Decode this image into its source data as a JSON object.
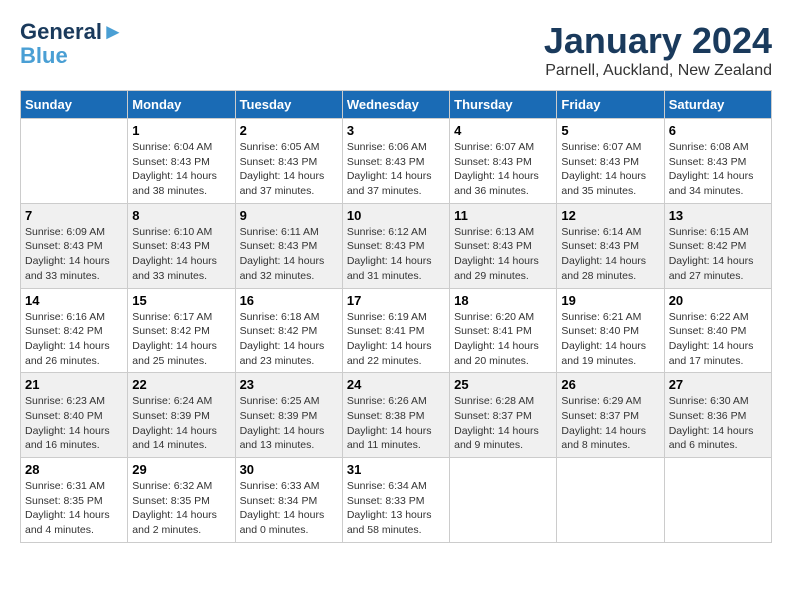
{
  "header": {
    "logo_line1": "General",
    "logo_line2": "Blue",
    "main_title": "January 2024",
    "subtitle": "Parnell, Auckland, New Zealand"
  },
  "calendar": {
    "headers": [
      "Sunday",
      "Monday",
      "Tuesday",
      "Wednesday",
      "Thursday",
      "Friday",
      "Saturday"
    ],
    "rows": [
      [
        {
          "day": "",
          "sunrise": "",
          "sunset": "",
          "daylight": ""
        },
        {
          "day": "1",
          "sunrise": "6:04 AM",
          "sunset": "8:43 PM",
          "daylight": "14 hours and 38 minutes."
        },
        {
          "day": "2",
          "sunrise": "6:05 AM",
          "sunset": "8:43 PM",
          "daylight": "14 hours and 37 minutes."
        },
        {
          "day": "3",
          "sunrise": "6:06 AM",
          "sunset": "8:43 PM",
          "daylight": "14 hours and 37 minutes."
        },
        {
          "day": "4",
          "sunrise": "6:07 AM",
          "sunset": "8:43 PM",
          "daylight": "14 hours and 36 minutes."
        },
        {
          "day": "5",
          "sunrise": "6:07 AM",
          "sunset": "8:43 PM",
          "daylight": "14 hours and 35 minutes."
        },
        {
          "day": "6",
          "sunrise": "6:08 AM",
          "sunset": "8:43 PM",
          "daylight": "14 hours and 34 minutes."
        }
      ],
      [
        {
          "day": "7",
          "sunrise": "6:09 AM",
          "sunset": "8:43 PM",
          "daylight": "14 hours and 33 minutes."
        },
        {
          "day": "8",
          "sunrise": "6:10 AM",
          "sunset": "8:43 PM",
          "daylight": "14 hours and 33 minutes."
        },
        {
          "day": "9",
          "sunrise": "6:11 AM",
          "sunset": "8:43 PM",
          "daylight": "14 hours and 32 minutes."
        },
        {
          "day": "10",
          "sunrise": "6:12 AM",
          "sunset": "8:43 PM",
          "daylight": "14 hours and 31 minutes."
        },
        {
          "day": "11",
          "sunrise": "6:13 AM",
          "sunset": "8:43 PM",
          "daylight": "14 hours and 29 minutes."
        },
        {
          "day": "12",
          "sunrise": "6:14 AM",
          "sunset": "8:43 PM",
          "daylight": "14 hours and 28 minutes."
        },
        {
          "day": "13",
          "sunrise": "6:15 AM",
          "sunset": "8:42 PM",
          "daylight": "14 hours and 27 minutes."
        }
      ],
      [
        {
          "day": "14",
          "sunrise": "6:16 AM",
          "sunset": "8:42 PM",
          "daylight": "14 hours and 26 minutes."
        },
        {
          "day": "15",
          "sunrise": "6:17 AM",
          "sunset": "8:42 PM",
          "daylight": "14 hours and 25 minutes."
        },
        {
          "day": "16",
          "sunrise": "6:18 AM",
          "sunset": "8:42 PM",
          "daylight": "14 hours and 23 minutes."
        },
        {
          "day": "17",
          "sunrise": "6:19 AM",
          "sunset": "8:41 PM",
          "daylight": "14 hours and 22 minutes."
        },
        {
          "day": "18",
          "sunrise": "6:20 AM",
          "sunset": "8:41 PM",
          "daylight": "14 hours and 20 minutes."
        },
        {
          "day": "19",
          "sunrise": "6:21 AM",
          "sunset": "8:40 PM",
          "daylight": "14 hours and 19 minutes."
        },
        {
          "day": "20",
          "sunrise": "6:22 AM",
          "sunset": "8:40 PM",
          "daylight": "14 hours and 17 minutes."
        }
      ],
      [
        {
          "day": "21",
          "sunrise": "6:23 AM",
          "sunset": "8:40 PM",
          "daylight": "14 hours and 16 minutes."
        },
        {
          "day": "22",
          "sunrise": "6:24 AM",
          "sunset": "8:39 PM",
          "daylight": "14 hours and 14 minutes."
        },
        {
          "day": "23",
          "sunrise": "6:25 AM",
          "sunset": "8:39 PM",
          "daylight": "14 hours and 13 minutes."
        },
        {
          "day": "24",
          "sunrise": "6:26 AM",
          "sunset": "8:38 PM",
          "daylight": "14 hours and 11 minutes."
        },
        {
          "day": "25",
          "sunrise": "6:28 AM",
          "sunset": "8:37 PM",
          "daylight": "14 hours and 9 minutes."
        },
        {
          "day": "26",
          "sunrise": "6:29 AM",
          "sunset": "8:37 PM",
          "daylight": "14 hours and 8 minutes."
        },
        {
          "day": "27",
          "sunrise": "6:30 AM",
          "sunset": "8:36 PM",
          "daylight": "14 hours and 6 minutes."
        }
      ],
      [
        {
          "day": "28",
          "sunrise": "6:31 AM",
          "sunset": "8:35 PM",
          "daylight": "14 hours and 4 minutes."
        },
        {
          "day": "29",
          "sunrise": "6:32 AM",
          "sunset": "8:35 PM",
          "daylight": "14 hours and 2 minutes."
        },
        {
          "day": "30",
          "sunrise": "6:33 AM",
          "sunset": "8:34 PM",
          "daylight": "14 hours and 0 minutes."
        },
        {
          "day": "31",
          "sunrise": "6:34 AM",
          "sunset": "8:33 PM",
          "daylight": "13 hours and 58 minutes."
        },
        {
          "day": "",
          "sunrise": "",
          "sunset": "",
          "daylight": ""
        },
        {
          "day": "",
          "sunrise": "",
          "sunset": "",
          "daylight": ""
        },
        {
          "day": "",
          "sunrise": "",
          "sunset": "",
          "daylight": ""
        }
      ]
    ]
  }
}
